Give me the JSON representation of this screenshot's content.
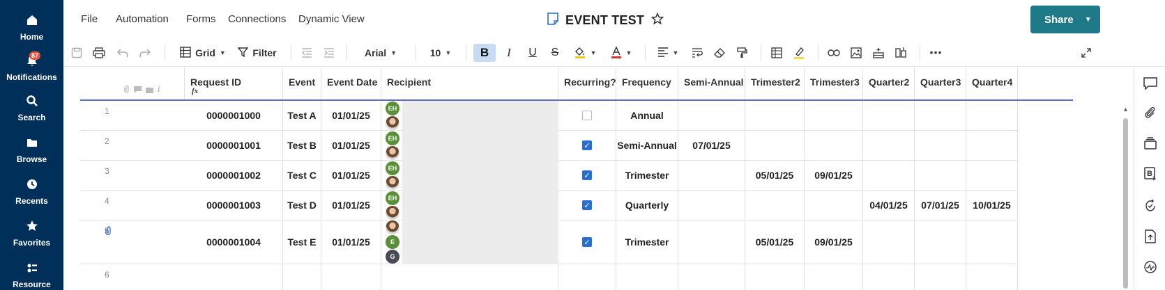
{
  "nav": {
    "items": [
      {
        "label": "Home",
        "icon": "home-icon"
      },
      {
        "label": "Notifications",
        "icon": "bell-icon",
        "badge": "87"
      },
      {
        "label": "Search",
        "icon": "search-icon"
      },
      {
        "label": "Browse",
        "icon": "folder-icon"
      },
      {
        "label": "Recents",
        "icon": "clock-icon"
      },
      {
        "label": "Favorites",
        "icon": "star-icon"
      },
      {
        "label": "Resource",
        "icon": "resource-icon"
      }
    ]
  },
  "menu": {
    "file": "File",
    "automation": "Automation",
    "forms": "Forms",
    "connections": "Connections",
    "dynamic_view": "Dynamic View"
  },
  "document": {
    "title": "EVENT TEST"
  },
  "share": {
    "label": "Share"
  },
  "toolbar": {
    "view_label": "Grid",
    "filter_label": "Filter",
    "font_family": "Arial",
    "font_size": "10",
    "bold": "B",
    "italic": "I",
    "underline": "U",
    "strike": "S"
  },
  "grid": {
    "columns": [
      "Request ID",
      "Event",
      "Event Date",
      "Recipient",
      "Recurring?",
      "Frequency",
      "Semi-Annual",
      "Trimester2",
      "Trimester3",
      "Quarter2",
      "Quarter3",
      "Quarter4"
    ],
    "formula_icon": "fx",
    "rows": [
      {
        "num": "1",
        "request_id": "0000001000",
        "event": "Test A",
        "event_date": "01/01/25",
        "recurring": false,
        "frequency": "Annual",
        "semi_annual": "",
        "trimester2": "",
        "trimester3": "",
        "quarter2": "",
        "quarter3": "",
        "quarter4": "",
        "avatars": [
          "EH",
          "photo"
        ],
        "attachment": false
      },
      {
        "num": "2",
        "request_id": "0000001001",
        "event": "Test B",
        "event_date": "01/01/25",
        "recurring": true,
        "frequency": "Semi-Annual",
        "semi_annual": "07/01/25",
        "trimester2": "",
        "trimester3": "",
        "quarter2": "",
        "quarter3": "",
        "quarter4": "",
        "avatars": [
          "EH",
          "photo"
        ],
        "attachment": false
      },
      {
        "num": "3",
        "request_id": "0000001002",
        "event": "Test C",
        "event_date": "01/01/25",
        "recurring": true,
        "frequency": "Trimester",
        "semi_annual": "",
        "trimester2": "05/01/25",
        "trimester3": "09/01/25",
        "quarter2": "",
        "quarter3": "",
        "quarter4": "",
        "avatars": [
          "EH",
          "photo"
        ],
        "attachment": false
      },
      {
        "num": "4",
        "request_id": "0000001003",
        "event": "Test D",
        "event_date": "01/01/25",
        "recurring": true,
        "frequency": "Quarterly",
        "semi_annual": "",
        "trimester2": "",
        "trimester3": "",
        "quarter2": "04/01/25",
        "quarter3": "07/01/25",
        "quarter4": "10/01/25",
        "avatars": [
          "EH",
          "photo"
        ],
        "attachment": false
      },
      {
        "num": "5",
        "request_id": "0000001004",
        "event": "Test E",
        "event_date": "01/01/25",
        "recurring": true,
        "frequency": "Trimester",
        "semi_annual": "",
        "trimester2": "05/01/25",
        "trimester3": "09/01/25",
        "quarter2": "",
        "quarter3": "",
        "quarter4": "",
        "avatars": [
          "photo",
          "E",
          "G"
        ],
        "attachment": true
      },
      {
        "num": "6",
        "request_id": "",
        "event": "",
        "event_date": "",
        "recurring": null,
        "frequency": "",
        "semi_annual": "",
        "trimester2": "",
        "trimester3": "",
        "quarter2": "",
        "quarter3": "",
        "quarter4": "",
        "avatars": [],
        "attachment": false
      }
    ]
  },
  "colors": {
    "nav_bg": "#003059",
    "accent": "#1f7a87",
    "checkbox": "#2a6fcf",
    "avatar_green": "#5a8f3a"
  }
}
